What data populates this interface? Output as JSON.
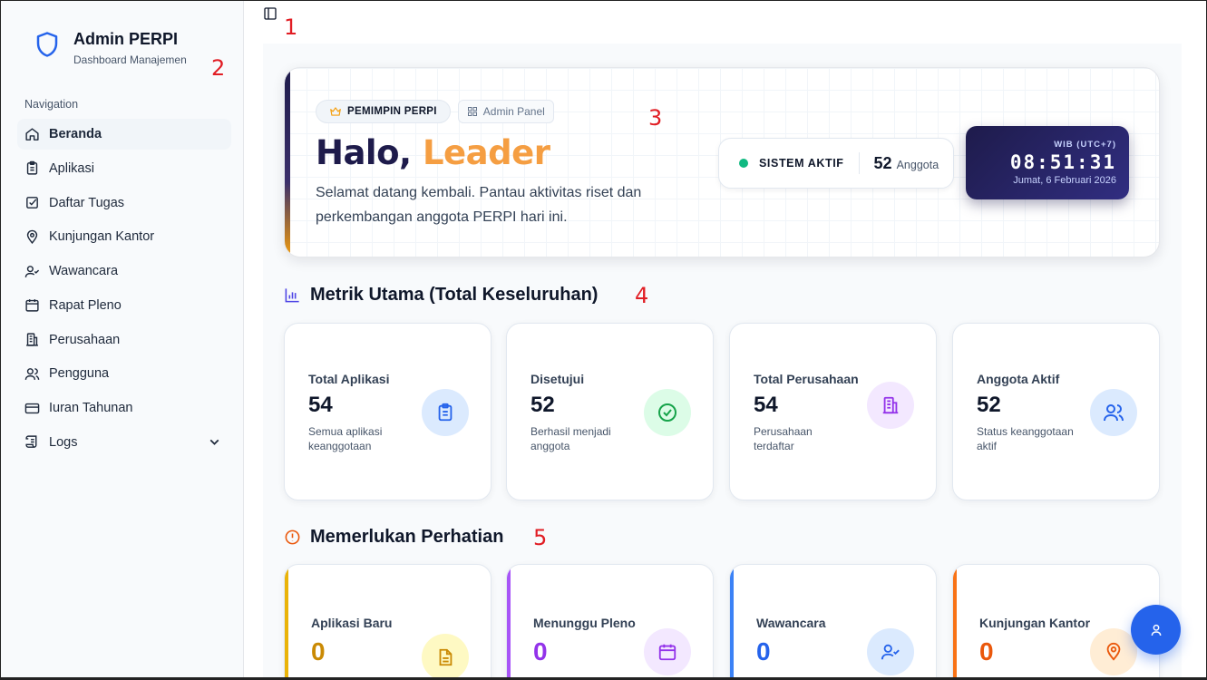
{
  "brand": {
    "title": "Admin PERPI",
    "subtitle": "Dashboard Manajemen"
  },
  "nav": {
    "heading": "Navigation",
    "items": [
      {
        "label": "Beranda",
        "icon": "home-icon",
        "active": true
      },
      {
        "label": "Aplikasi",
        "icon": "clipboard-icon"
      },
      {
        "label": "Daftar Tugas",
        "icon": "checkbox-icon"
      },
      {
        "label": "Kunjungan Kantor",
        "icon": "map-pin-icon"
      },
      {
        "label": "Wawancara",
        "icon": "user-check-icon"
      },
      {
        "label": "Rapat Pleno",
        "icon": "calendar-icon"
      },
      {
        "label": "Perusahaan",
        "icon": "building-icon"
      },
      {
        "label": "Pengguna",
        "icon": "users-icon"
      },
      {
        "label": "Iuran Tahunan",
        "icon": "credit-card-icon"
      },
      {
        "label": "Logs",
        "icon": "scroll-icon",
        "expandable": true
      }
    ]
  },
  "annotations": [
    "1",
    "2",
    "3",
    "4",
    "5"
  ],
  "hero": {
    "badge_leader": "PEMIMPIN PERPI",
    "badge_admin": "Admin Panel",
    "greeting": "Halo,",
    "name": "Leader",
    "description": "Selamat datang kembali. Pantau aktivitas riset dan perkembangan anggota PERPI hari ini.",
    "status": "SISTEM AKTIF",
    "member_count": "52",
    "member_label": "Anggota",
    "clock": {
      "timezone": "WIB (UTC+7)",
      "time": "08:51:31",
      "date": "Jumat, 6 Februari 2026"
    }
  },
  "metrics": {
    "title": "Metrik Utama (Total Keseluruhan)",
    "cards": [
      {
        "label": "Total Aplikasi",
        "value": "54",
        "note": "Semua aplikasi keanggotaan",
        "icon": "clipboard-list-icon",
        "color": "#2563eb",
        "bg": "#dbeafe"
      },
      {
        "label": "Disetujui",
        "value": "52",
        "note": "Berhasil menjadi anggota",
        "icon": "check-circle-icon",
        "color": "#16a34a",
        "bg": "#dcfce7"
      },
      {
        "label": "Total Perusahaan",
        "value": "54",
        "note": "Perusahaan terdaftar",
        "icon": "building-icon",
        "color": "#9333ea",
        "bg": "#f3e8ff"
      },
      {
        "label": "Anggota Aktif",
        "value": "52",
        "note": "Status keanggotaan aktif",
        "icon": "users-icon",
        "color": "#2563eb",
        "bg": "#dbeafe"
      }
    ]
  },
  "attention": {
    "title": "Memerlukan Perhatian",
    "cards": [
      {
        "label": "Aplikasi Baru",
        "value": "0",
        "icon": "file-text-icon",
        "color": "#ca8a04",
        "bg": "#fef9c3",
        "edge": "#eab308"
      },
      {
        "label": "Menunggu Pleno",
        "value": "0",
        "icon": "calendar-icon",
        "color": "#9333ea",
        "bg": "#f3e8ff",
        "edge": "#a855f7"
      },
      {
        "label": "Wawancara",
        "value": "0",
        "icon": "user-check-icon",
        "color": "#2563eb",
        "bg": "#dbeafe",
        "edge": "#3b82f6"
      },
      {
        "label": "Kunjungan Kantor",
        "value": "0",
        "icon": "map-pin-icon",
        "color": "#ea580c",
        "bg": "#ffedd5",
        "edge": "#f97316"
      }
    ]
  }
}
